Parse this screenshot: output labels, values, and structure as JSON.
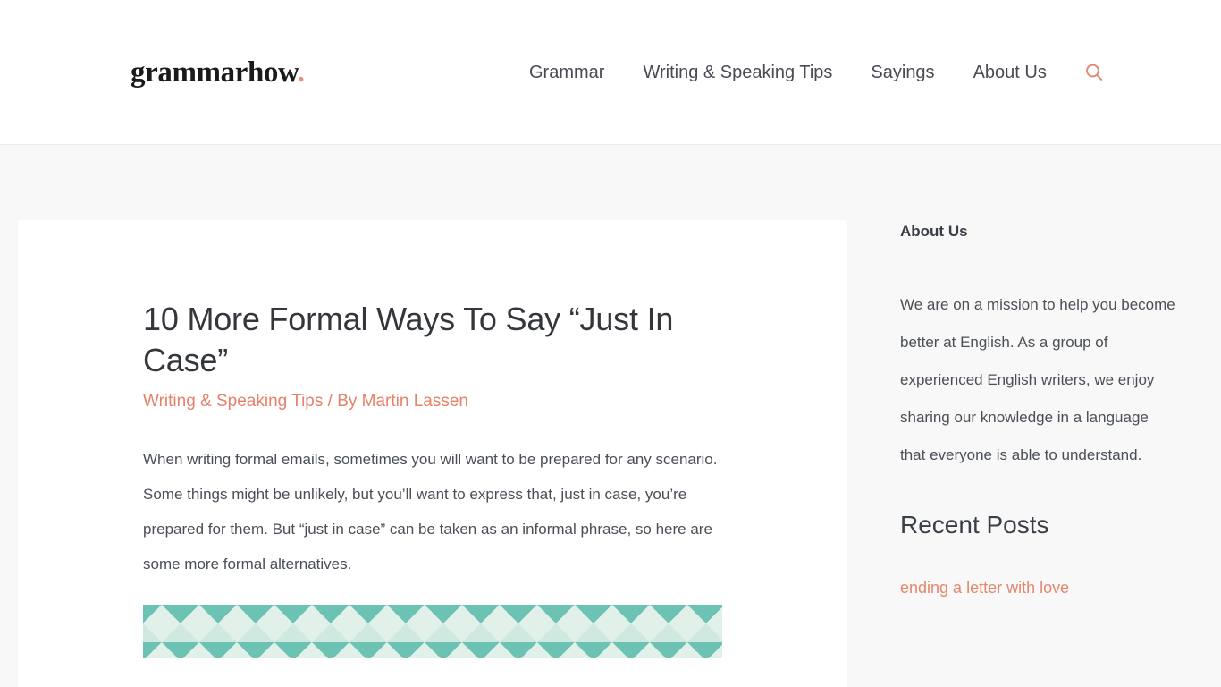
{
  "site": {
    "logo_text": "grammarhow",
    "logo_dot": ".",
    "background_color": "#f8f8f8",
    "accent_color": "#e5826a"
  },
  "header": {
    "nav_items": [
      {
        "label": "Grammar"
      },
      {
        "label": "Writing & Speaking Tips"
      },
      {
        "label": "Sayings"
      },
      {
        "label": "About Us"
      }
    ],
    "search_icon": "search-icon"
  },
  "article": {
    "title": "10 More Formal Ways To Say “Just In Case”",
    "category": "Writing & Speaking Tips",
    "separator": " / ",
    "author_prefix": "By ",
    "author": "Martin Lassen",
    "paragraphs": [
      "When writing formal emails, sometimes you will want to be prepared for any scenario. Some things might be unlikely, but you’ll want to express that, just in case, you’re prepared for them. But “just in case” can be taken as an informal phrase, so here are some more formal alternatives."
    ],
    "figure_alt": "zigzag-pattern-banner"
  },
  "sidebar": {
    "about": {
      "title": "About Us",
      "text": "We are on a mission to help you become better at English. As a group of experienced English writers, we enjoy sharing our knowledge in a language that everyone is able to understand."
    },
    "recent": {
      "title": "Recent Posts",
      "items": [
        {
          "label": "ending a letter with love"
        }
      ]
    }
  }
}
